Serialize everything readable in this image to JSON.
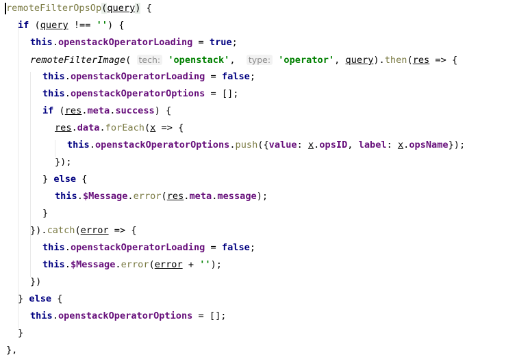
{
  "code": {
    "fn_name": "remoteFilterOpsOp",
    "param": "query",
    "kw_if": "if",
    "kw_this": "this",
    "kw_true": "true",
    "kw_false": "false",
    "kw_else": "else",
    "op_neq": " !== ",
    "empty_str": "''",
    "field_loading": "openstackOperatorLoading",
    "field_options": "openstackOperatorOptions",
    "call_remote": "remoteFilterImage",
    "hint_tech": "tech:",
    "arg_tech": "'openstack'",
    "hint_type": "type:",
    "arg_type": "'operator'",
    "then": "then",
    "res": "res",
    "meta": "meta",
    "success": "success",
    "data": "data",
    "forEach": "forEach",
    "x": "x",
    "push": "push",
    "value_key": "value",
    "opsID": "opsID",
    "label_key": "label",
    "opsName": "opsName",
    "message_obj": "$Message",
    "error_fn": "error",
    "message_prop": "message",
    "catch": "catch",
    "error_var": "error"
  }
}
